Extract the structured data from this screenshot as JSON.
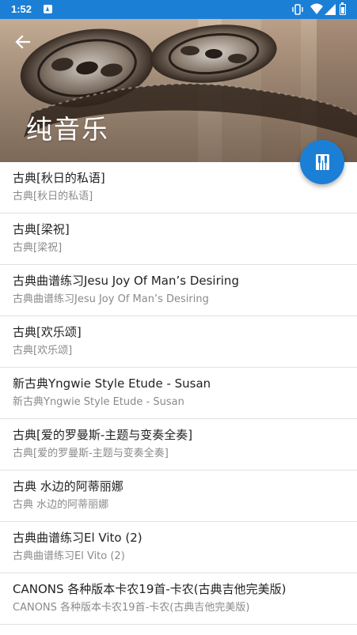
{
  "status_bar": {
    "time": "1:52"
  },
  "header": {
    "title": "纯音乐",
    "back_icon": "arrow-back-icon"
  },
  "fab": {
    "icon": "piano-icon",
    "color": "#1c7fd6"
  },
  "songs": [
    {
      "title": "古典[秋日的私语]",
      "subtitle": "古典[秋日的私语]"
    },
    {
      "title": "古典[梁祝]",
      "subtitle": "古典[梁祝]"
    },
    {
      "title": "古典曲谱练习Jesu Joy Of Man’s Desiring",
      "subtitle": "古典曲谱练习Jesu Joy Of Man’s Desiring"
    },
    {
      "title": "古典[欢乐颂]",
      "subtitle": "古典[欢乐颂]"
    },
    {
      "title": "新古典Yngwie Style Etude - Susan",
      "subtitle": "新古典Yngwie Style Etude - Susan"
    },
    {
      "title": "古典[爱的罗曼斯-主题与变奏全奏]",
      "subtitle": "古典[爱的罗曼斯-主题与变奏全奏]"
    },
    {
      "title": "古典 水边的阿蒂丽娜",
      "subtitle": "古典 水边的阿蒂丽娜"
    },
    {
      "title": "古典曲谱练习El Vito (2)",
      "subtitle": "古典曲谱练习El Vito (2)"
    },
    {
      "title": "CANONS 各种版本卡农19首-卡农(古典吉他完美版)",
      "subtitle": "CANONS 各种版本卡农19首-卡农(古典吉他完美版)"
    }
  ]
}
